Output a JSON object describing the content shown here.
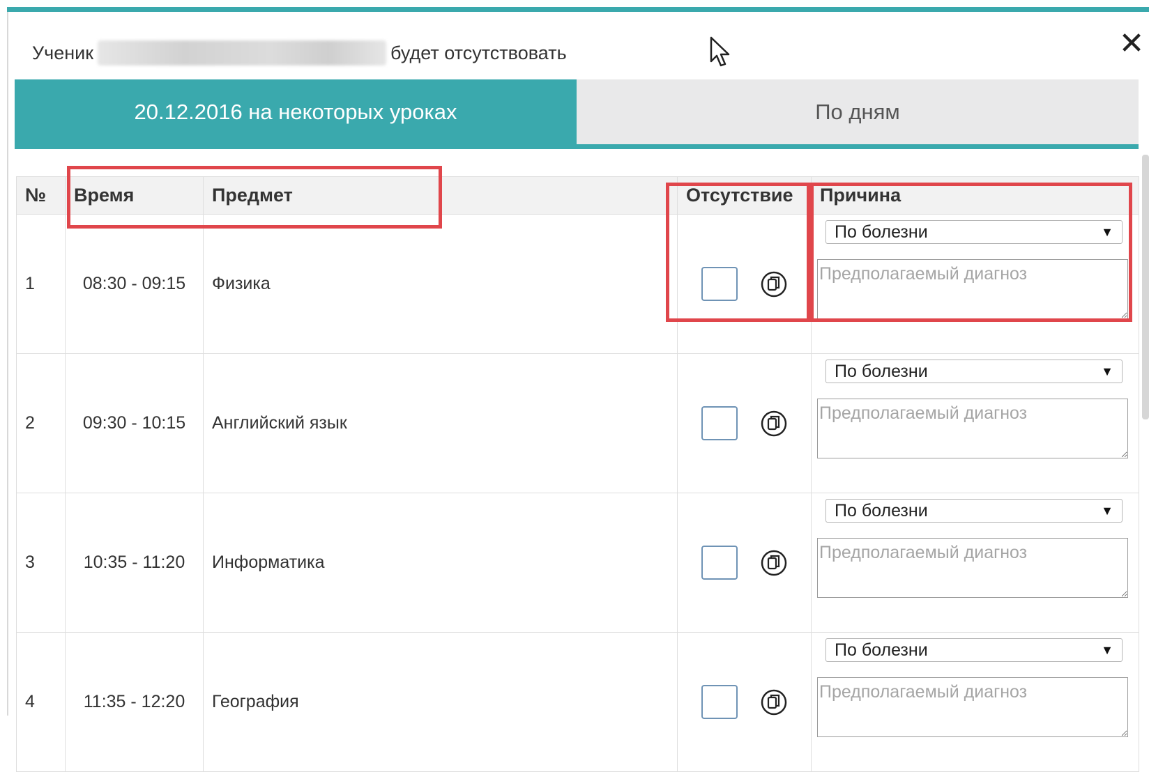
{
  "dialog": {
    "prefix": "Ученик",
    "suffix": "будет отсутствовать",
    "close_symbol": "✕"
  },
  "tabs": [
    {
      "label": "20.12.2016 на некоторых уроках",
      "active": true
    },
    {
      "label": "По дням",
      "active": false
    }
  ],
  "table": {
    "headers": {
      "num": "№",
      "time": "Время",
      "subject": "Предмет",
      "absence": "Отсутствие",
      "reason": "Причина"
    },
    "rows": [
      {
        "num": "1",
        "time": "08:30 - 09:15",
        "subject": "Физика",
        "reason": "По болезни",
        "diagnosis_placeholder": "Предполагаемый диагноз"
      },
      {
        "num": "2",
        "time": "09:30 - 10:15",
        "subject": "Английский язык",
        "reason": "По болезни",
        "diagnosis_placeholder": "Предполагаемый диагноз"
      },
      {
        "num": "3",
        "time": "10:35 - 11:20",
        "subject": "Информатика",
        "reason": "По болезни",
        "diagnosis_placeholder": "Предполагаемый диагноз"
      },
      {
        "num": "4",
        "time": "11:35 - 12:20",
        "subject": "География",
        "reason": "По болезни",
        "diagnosis_placeholder": "Предполагаемый диагноз"
      }
    ]
  },
  "icons": {
    "copy": "copy-icon",
    "close": "close-icon",
    "dropdown": "chevron-down-icon",
    "cursor": "mouse-cursor-icon"
  },
  "colors": {
    "accent": "#3aa9ad",
    "highlight": "#e0464b",
    "checkbox_border": "#6f93b5"
  }
}
